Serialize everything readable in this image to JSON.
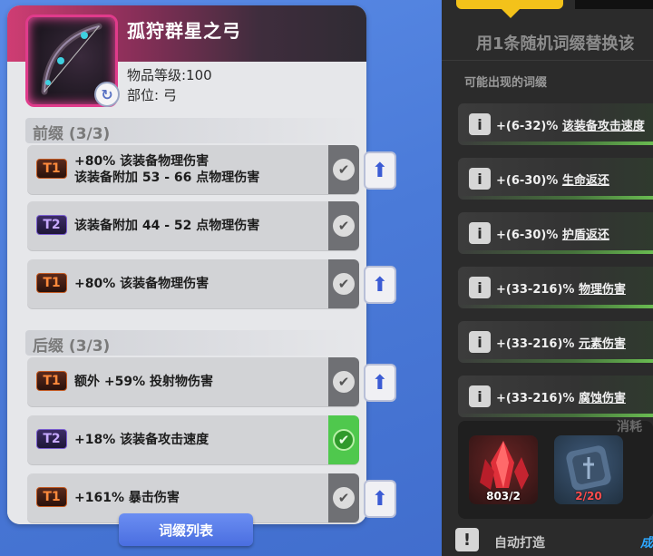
{
  "item": {
    "name": "孤狩群星之弓",
    "level": "物品等级:100",
    "slot": "部位: 弓"
  },
  "prefix": {
    "title": "前缀 (3/3)",
    "affixes": [
      {
        "tier": "T1",
        "line1": "+80% 该装备物理伤害",
        "line2": "该装备附加 53 - 66 点物理伤害",
        "locked": true
      },
      {
        "tier": "T2",
        "line1": "该装备附加 44 - 52 点物理伤害",
        "line2": "",
        "locked": true
      },
      {
        "tier": "T1",
        "line1": "+80% 该装备物理伤害",
        "line2": "",
        "locked": true
      }
    ]
  },
  "suffix": {
    "title": "后缀 (3/3)",
    "affixes": [
      {
        "tier": "T1",
        "line1": "额外 +59% 投射物伤害",
        "line2": "",
        "locked": true
      },
      {
        "tier": "T2",
        "line1": "+18% 该装备攻击速度",
        "line2": "",
        "locked": true,
        "selected": true
      },
      {
        "tier": "T1",
        "line1": "+161% 暴击伤害",
        "line2": "",
        "locked": true
      }
    ]
  },
  "affix_list_button": "词缀列表",
  "right_panel": {
    "title": "用1条随机词缀替换该",
    "subtitle": "可能出现的词缀",
    "pool": [
      {
        "prefix": "+(6-32)% ",
        "name": "该装备攻击速度"
      },
      {
        "prefix": "+(6-30)% ",
        "name": "生命返还"
      },
      {
        "prefix": "+(6-30)% ",
        "name": "护盾返还"
      },
      {
        "prefix": "+(33-216)% ",
        "name": "物理伤害"
      },
      {
        "prefix": "+(33-216)% ",
        "name": "元素伤害"
      },
      {
        "prefix": "+(33-216)% ",
        "name": "腐蚀伤害"
      }
    ],
    "cost_label": "消耗",
    "materials": [
      {
        "name": "red-crystal",
        "qty": "803/2"
      },
      {
        "name": "blue-rune",
        "qty": "2/20"
      }
    ],
    "auto_craft": "自动打造",
    "edge_text": "成"
  },
  "colors": {
    "tier_t1": "#ff8a3c",
    "tier_t2": "#c7a9ff",
    "selected_check": "#4fc84d",
    "accent_blue": "#4a6ee0",
    "tab_yellow": "#f3c21a"
  }
}
